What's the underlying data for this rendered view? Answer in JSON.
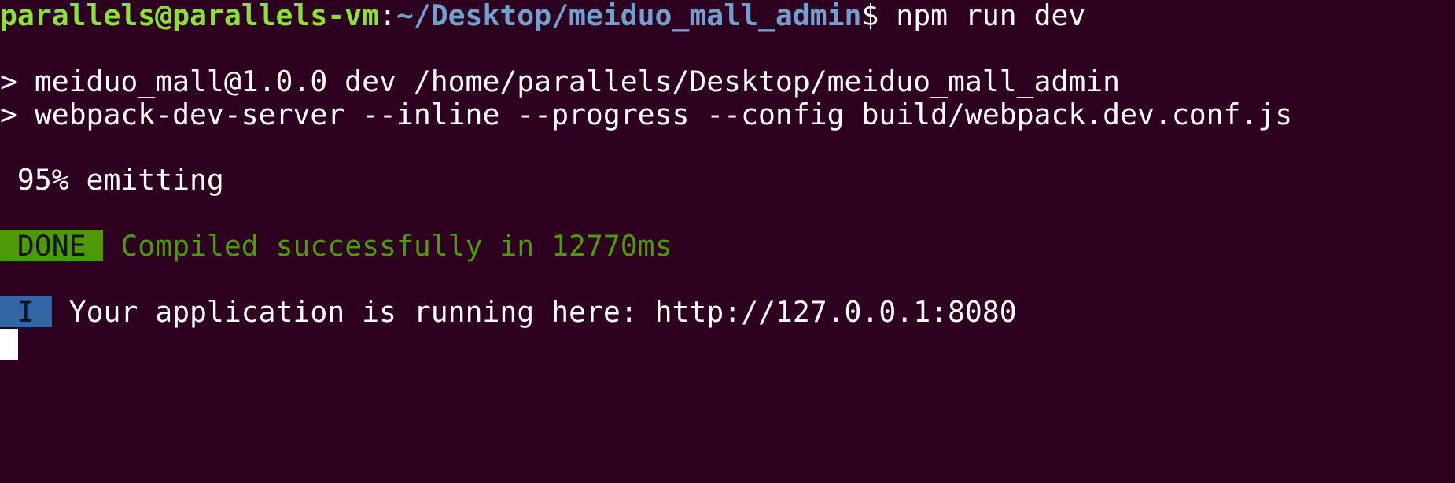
{
  "prompt": {
    "user_host": "parallels@parallels-vm",
    "separator": ":",
    "path": "~/Desktop/meiduo_mall_admin",
    "symbol": "$",
    "command": " npm run dev"
  },
  "output": {
    "line1": "> meiduo_mall@1.0.0 dev /home/parallels/Desktop/meiduo_mall_admin",
    "line2": "> webpack-dev-server --inline --progress --config build/webpack.dev.conf.js",
    "progress": " 95% emitting",
    "done_badge": " DONE ",
    "done_message": "Compiled successfully in 12770ms",
    "info_badge": " I ",
    "info_message": "Your application is running here: http://127.0.0.1:8080"
  },
  "colors": {
    "background": "#2c001e",
    "prompt_user": "#8ae234",
    "prompt_path": "#729fcf",
    "done": "#4e9a06",
    "info": "#3465a4"
  }
}
